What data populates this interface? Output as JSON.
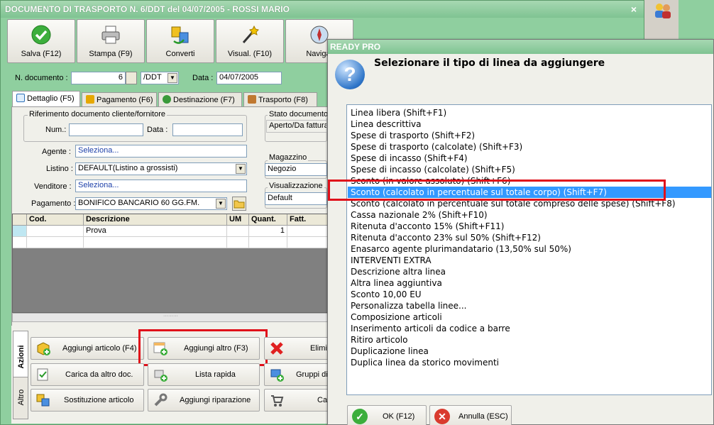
{
  "window": {
    "title": "DOCUMENTO DI TRASPORTO N. 6/DDT del 04/07/2005 - ROSSI MARIO",
    "close_glyph": "×"
  },
  "toolbar": [
    {
      "label": "Salva (F12)",
      "icon": "check-icon"
    },
    {
      "label": "Stampa (F9)",
      "icon": "printer-icon"
    },
    {
      "label": "Converti",
      "icon": "convert-icon"
    },
    {
      "label": "Visual. (F10)",
      "icon": "magic-wand-icon"
    },
    {
      "label": "Navigat",
      "icon": "compass-icon"
    }
  ],
  "header": {
    "doc_number_label": "N. documento :",
    "doc_number": "6",
    "doc_series": "/DDT",
    "date_label": "Data :",
    "date": "04/07/2005"
  },
  "tabs": [
    "Dettaglio (F5)",
    "Pagamento (F6)",
    "Destinazione (F7)",
    "Trasporto (F8)"
  ],
  "riferimento": {
    "title": "Riferimento documento cliente/fornitore",
    "num_label": "Num.:",
    "num_value": "",
    "data_label": "Data :",
    "data_value": ""
  },
  "stato": {
    "title": "Stato documento",
    "value": "Aperto/Da fatturar"
  },
  "form": {
    "agente_label": "Agente :",
    "agente_value": "Seleziona...",
    "listino_label": "Listino :",
    "listino_value": "DEFAULT(Listino a grossisti)",
    "venditore_label": "Venditore :",
    "venditore_value": "Seleziona...",
    "pagamento_label": "Pagamento :",
    "pagamento_value": "BONIFICO BANCARIO 60 GG.FM."
  },
  "magazzino": {
    "title": "Magazzino",
    "value": "Negozio"
  },
  "visualizzazione": {
    "title": "Visualizzazione",
    "value": "Default"
  },
  "grid": {
    "columns": [
      "Cod.",
      "Descrizione",
      "UM",
      "Quant.",
      "Fatt."
    ],
    "rows": [
      {
        "cod": "",
        "descrizione": "Prova",
        "um": "",
        "quant": "1",
        "fatt": ""
      }
    ]
  },
  "side_tabs": [
    "Azioni",
    "Altro"
  ],
  "actions": {
    "aggiungi_articolo": "Aggiungi articolo (F4)",
    "aggiungi_altro": "Aggiungi altro (F3)",
    "elimina": "Elimi",
    "carica": "Carica da altro doc.",
    "lista_rapida": "Lista rapida",
    "gruppi": "Gruppi di",
    "sostituzione": "Sostituzione articolo",
    "aggiungi_riparazione": "Aggiungi riparazione",
    "ca": "Ca"
  },
  "dialog": {
    "title": "READY PRO",
    "prompt": "Selezionare il tipo di linea da aggiungere",
    "items": [
      "Linea libera (Shift+F1)",
      "Linea descrittiva",
      "Spese di trasporto (Shift+F2)",
      "Spese di trasporto (calcolate) (Shift+F3)",
      "Spese di incasso (Shift+F4)",
      "Spese di incasso (calcolate) (Shift+F5)",
      "Sconto (in valore assoluto) (Shift+F6)",
      "Sconto (calcolato in percentuale sul totale corpo) (Shift+F7)",
      "Sconto (calcolato in percentuale sul totale compreso delle spese) (Shift+F8)",
      "Cassa nazionale 2% (Shift+F10)",
      "Ritenuta d'acconto 15% (Shift+F11)",
      "Ritenuta d'acconto 23% sul 50% (Shift+F12)",
      "Enasarco agente plurimandatario (13,50% sul 50%)",
      "INTERVENTI EXTRA",
      "Descrizione altra linea",
      "Altra linea aggiuntiva",
      "Sconto 10,00 EU",
      "Personalizza tabella linee...",
      "Composizione articoli",
      "Inserimento articoli da codice a barre",
      "Ritiro articolo",
      "Duplicazione linea",
      "Duplica linea da storico movimenti"
    ],
    "selected_index": 7,
    "ok_label": "OK (F12)",
    "cancel_label": "Annulla (ESC)"
  },
  "colors": {
    "window": "#8fcf9f",
    "selection": "#3399ff",
    "highlight": "#e0101a"
  }
}
